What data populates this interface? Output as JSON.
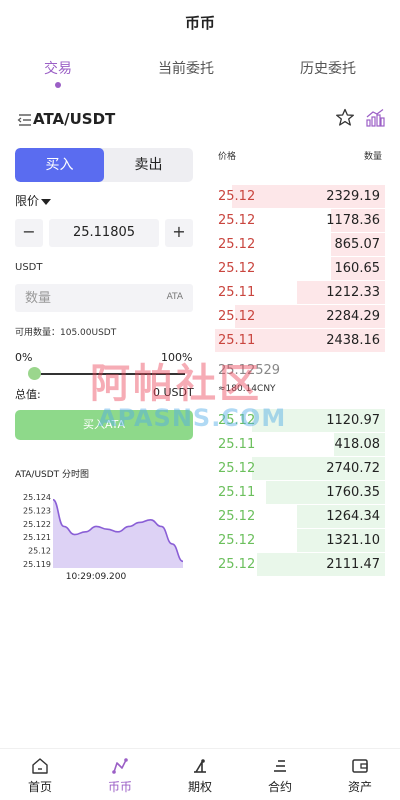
{
  "page": {
    "title": "币币"
  },
  "tabs": [
    {
      "label": "交易",
      "active": true
    },
    {
      "label": "当前委托",
      "active": false
    },
    {
      "label": "历史委托",
      "active": false
    }
  ],
  "pair": {
    "name": "ATA/USDT",
    "menu_icon": "list-menu-icon",
    "star_icon": "star-icon",
    "chart_icon": "bar-chart-icon"
  },
  "trade_form": {
    "buy_label": "买入",
    "sell_label": "卖出",
    "order_type": "限价",
    "price_value": "25.11805",
    "minus_label": "−",
    "plus_label": "+",
    "unit_label": "USDT",
    "quantity_placeholder": "数量",
    "quantity_unit": "ATA",
    "available": "可用数量：105.00USDT",
    "pct_min": "0%",
    "pct_max": "100%",
    "slider_fraction": 0,
    "total_label": "总值:",
    "total_value": "0 USDT",
    "submit_label": "买入ATA"
  },
  "mini_chart": {
    "title": "ATA/USDT 分时图",
    "time_label": "10:29:09.200"
  },
  "orderbook": {
    "price_header": "价格",
    "qty_header": "数量",
    "asks": [
      {
        "price": "25.12",
        "qty": "2329.19",
        "depth": 0.9
      },
      {
        "price": "25.12",
        "qty": "1178.36",
        "depth": 0.32
      },
      {
        "price": "25.12",
        "qty": "865.07",
        "depth": 0.32
      },
      {
        "price": "25.12",
        "qty": "160.65",
        "depth": 0.32
      },
      {
        "price": "25.11",
        "qty": "1212.33",
        "depth": 0.52
      },
      {
        "price": "25.12",
        "qty": "2284.29",
        "depth": 0.88
      },
      {
        "price": "25.11",
        "qty": "2438.16",
        "depth": 1.0
      }
    ],
    "mid_price": "25.12529",
    "mid_cny": "≈180.14CNY",
    "bids": [
      {
        "price": "25.12",
        "qty": "1120.97",
        "depth": 0.78
      },
      {
        "price": "25.11",
        "qty": "418.08",
        "depth": 0.3
      },
      {
        "price": "25.12",
        "qty": "2740.72",
        "depth": 0.78
      },
      {
        "price": "25.11",
        "qty": "1760.35",
        "depth": 0.7
      },
      {
        "price": "25.12",
        "qty": "1264.34",
        "depth": 0.52
      },
      {
        "price": "25.12",
        "qty": "1321.10",
        "depth": 0.52
      },
      {
        "price": "25.12",
        "qty": "2111.47",
        "depth": 0.75
      }
    ]
  },
  "watermark": {
    "main": "阿帕社区",
    "sub": "APASNS.COM"
  },
  "bottom_nav": [
    {
      "label": "首页",
      "icon": "home-icon",
      "active": false
    },
    {
      "label": "币币",
      "icon": "coin-trade-icon",
      "active": true
    },
    {
      "label": "期权",
      "icon": "options-icon",
      "active": false
    },
    {
      "label": "合约",
      "icon": "contract-icon",
      "active": false
    },
    {
      "label": "资产",
      "icon": "wallet-icon",
      "active": false
    }
  ],
  "chart_data": {
    "type": "area",
    "title": "ATA/USDT 分时图",
    "x": [
      "10:29:09.200"
    ],
    "yticks": [
      "25.124",
      "25.123",
      "25.122",
      "25.121",
      "25.12",
      "25.119"
    ],
    "ylim": [
      25.119,
      25.124
    ],
    "series": [
      {
        "values": [
          25.1238,
          25.1218,
          25.1212,
          25.1214,
          25.1218,
          25.1216,
          25.1214,
          25.1218,
          25.1221,
          25.1223,
          25.1218,
          25.1205,
          25.1192
        ]
      }
    ],
    "colors": {
      "line": "#8a5fd6",
      "fill": "#ddd2f5"
    }
  }
}
